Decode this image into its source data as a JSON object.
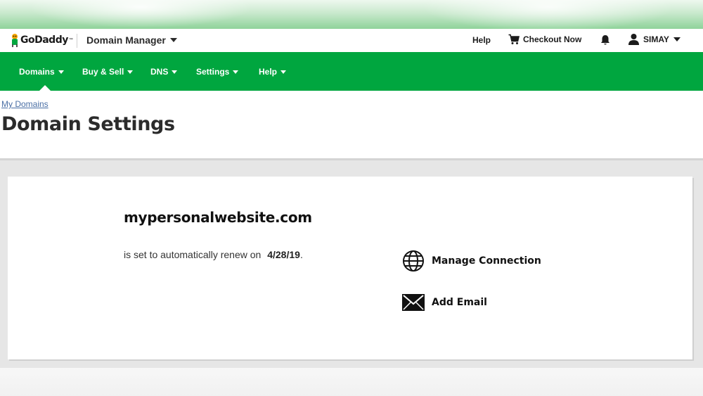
{
  "header": {
    "logo_text": "GoDaddy",
    "logo_tm": "™",
    "app_title": "Domain Manager",
    "help_label": "Help",
    "checkout_label": "Checkout Now",
    "user_name": "SIMAY"
  },
  "nav": {
    "items": [
      {
        "label": "Domains"
      },
      {
        "label": "Buy & Sell"
      },
      {
        "label": "DNS"
      },
      {
        "label": "Settings"
      },
      {
        "label": "Help"
      }
    ]
  },
  "breadcrumb": "My Domains",
  "page_title": "Domain Settings",
  "domain": {
    "name": "mypersonalwebsite.com",
    "renew_text": "is set to automatically renew on",
    "renew_date": "4/28/19",
    "renew_suffix": "."
  },
  "actions": {
    "manage_connection": "Manage Connection",
    "add_email": "Add Email"
  },
  "icons": {
    "logo": "godaddy-logo-icon",
    "cart": "cart-icon",
    "bell": "bell-icon",
    "user": "user-icon",
    "globe": "globe-icon",
    "envelope": "envelope-icon"
  },
  "colors": {
    "brand_green": "#00a63f",
    "link_blue": "#4a6fa5",
    "text_dark": "#2b2b2b"
  }
}
